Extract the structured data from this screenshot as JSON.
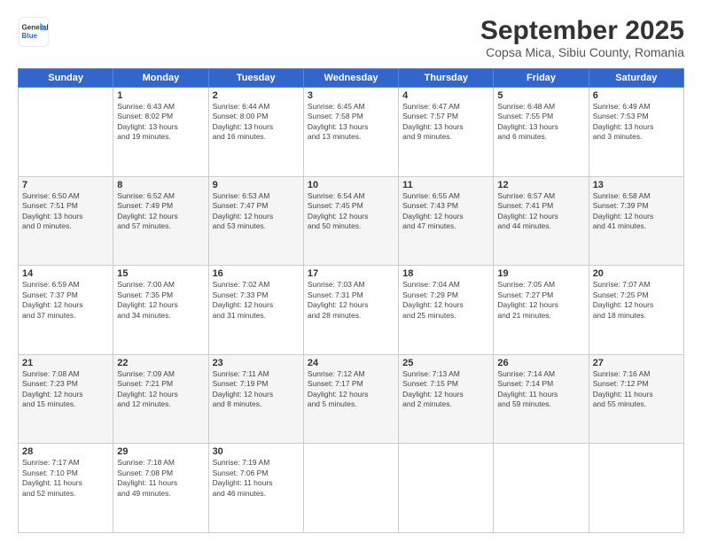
{
  "header": {
    "logo_line1": "General",
    "logo_line2": "Blue",
    "month": "September 2025",
    "location": "Copsa Mica, Sibiu County, Romania"
  },
  "days_of_week": [
    "Sunday",
    "Monday",
    "Tuesday",
    "Wednesday",
    "Thursday",
    "Friday",
    "Saturday"
  ],
  "weeks": [
    [
      {
        "num": "",
        "info": ""
      },
      {
        "num": "1",
        "info": "Sunrise: 6:43 AM\nSunset: 8:02 PM\nDaylight: 13 hours\nand 19 minutes."
      },
      {
        "num": "2",
        "info": "Sunrise: 6:44 AM\nSunset: 8:00 PM\nDaylight: 13 hours\nand 16 minutes."
      },
      {
        "num": "3",
        "info": "Sunrise: 6:45 AM\nSunset: 7:58 PM\nDaylight: 13 hours\nand 13 minutes."
      },
      {
        "num": "4",
        "info": "Sunrise: 6:47 AM\nSunset: 7:57 PM\nDaylight: 13 hours\nand 9 minutes."
      },
      {
        "num": "5",
        "info": "Sunrise: 6:48 AM\nSunset: 7:55 PM\nDaylight: 13 hours\nand 6 minutes."
      },
      {
        "num": "6",
        "info": "Sunrise: 6:49 AM\nSunset: 7:53 PM\nDaylight: 13 hours\nand 3 minutes."
      }
    ],
    [
      {
        "num": "7",
        "info": "Sunrise: 6:50 AM\nSunset: 7:51 PM\nDaylight: 13 hours\nand 0 minutes."
      },
      {
        "num": "8",
        "info": "Sunrise: 6:52 AM\nSunset: 7:49 PM\nDaylight: 12 hours\nand 57 minutes."
      },
      {
        "num": "9",
        "info": "Sunrise: 6:53 AM\nSunset: 7:47 PM\nDaylight: 12 hours\nand 53 minutes."
      },
      {
        "num": "10",
        "info": "Sunrise: 6:54 AM\nSunset: 7:45 PM\nDaylight: 12 hours\nand 50 minutes."
      },
      {
        "num": "11",
        "info": "Sunrise: 6:55 AM\nSunset: 7:43 PM\nDaylight: 12 hours\nand 47 minutes."
      },
      {
        "num": "12",
        "info": "Sunrise: 6:57 AM\nSunset: 7:41 PM\nDaylight: 12 hours\nand 44 minutes."
      },
      {
        "num": "13",
        "info": "Sunrise: 6:58 AM\nSunset: 7:39 PM\nDaylight: 12 hours\nand 41 minutes."
      }
    ],
    [
      {
        "num": "14",
        "info": "Sunrise: 6:59 AM\nSunset: 7:37 PM\nDaylight: 12 hours\nand 37 minutes."
      },
      {
        "num": "15",
        "info": "Sunrise: 7:00 AM\nSunset: 7:35 PM\nDaylight: 12 hours\nand 34 minutes."
      },
      {
        "num": "16",
        "info": "Sunrise: 7:02 AM\nSunset: 7:33 PM\nDaylight: 12 hours\nand 31 minutes."
      },
      {
        "num": "17",
        "info": "Sunrise: 7:03 AM\nSunset: 7:31 PM\nDaylight: 12 hours\nand 28 minutes."
      },
      {
        "num": "18",
        "info": "Sunrise: 7:04 AM\nSunset: 7:29 PM\nDaylight: 12 hours\nand 25 minutes."
      },
      {
        "num": "19",
        "info": "Sunrise: 7:05 AM\nSunset: 7:27 PM\nDaylight: 12 hours\nand 21 minutes."
      },
      {
        "num": "20",
        "info": "Sunrise: 7:07 AM\nSunset: 7:25 PM\nDaylight: 12 hours\nand 18 minutes."
      }
    ],
    [
      {
        "num": "21",
        "info": "Sunrise: 7:08 AM\nSunset: 7:23 PM\nDaylight: 12 hours\nand 15 minutes."
      },
      {
        "num": "22",
        "info": "Sunrise: 7:09 AM\nSunset: 7:21 PM\nDaylight: 12 hours\nand 12 minutes."
      },
      {
        "num": "23",
        "info": "Sunrise: 7:11 AM\nSunset: 7:19 PM\nDaylight: 12 hours\nand 8 minutes."
      },
      {
        "num": "24",
        "info": "Sunrise: 7:12 AM\nSunset: 7:17 PM\nDaylight: 12 hours\nand 5 minutes."
      },
      {
        "num": "25",
        "info": "Sunrise: 7:13 AM\nSunset: 7:15 PM\nDaylight: 12 hours\nand 2 minutes."
      },
      {
        "num": "26",
        "info": "Sunrise: 7:14 AM\nSunset: 7:14 PM\nDaylight: 11 hours\nand 59 minutes."
      },
      {
        "num": "27",
        "info": "Sunrise: 7:16 AM\nSunset: 7:12 PM\nDaylight: 11 hours\nand 55 minutes."
      }
    ],
    [
      {
        "num": "28",
        "info": "Sunrise: 7:17 AM\nSunset: 7:10 PM\nDaylight: 11 hours\nand 52 minutes."
      },
      {
        "num": "29",
        "info": "Sunrise: 7:18 AM\nSunset: 7:08 PM\nDaylight: 11 hours\nand 49 minutes."
      },
      {
        "num": "30",
        "info": "Sunrise: 7:19 AM\nSunset: 7:06 PM\nDaylight: 11 hours\nand 46 minutes."
      },
      {
        "num": "",
        "info": ""
      },
      {
        "num": "",
        "info": ""
      },
      {
        "num": "",
        "info": ""
      },
      {
        "num": "",
        "info": ""
      }
    ]
  ]
}
